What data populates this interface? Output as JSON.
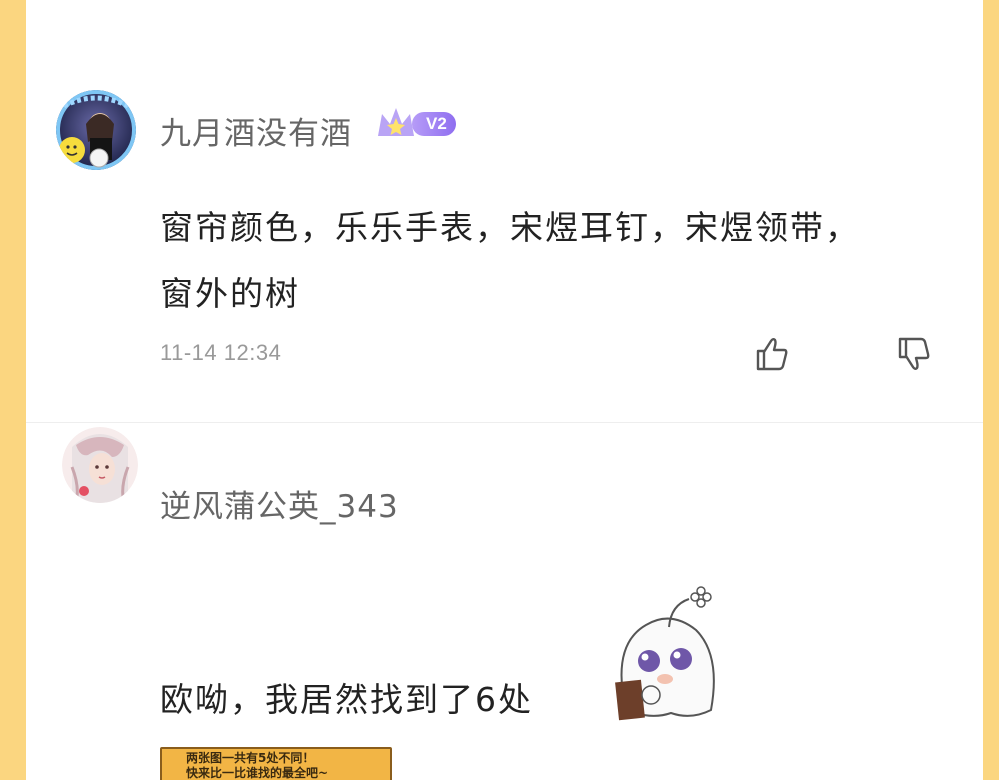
{
  "comments": [
    {
      "username": "九月酒没有酒",
      "level_badge": "V2",
      "text_line1": "窗帘颜色，乐乐手表，宋煜耳钉，宋煜领带，",
      "text_line2": "窗外的树",
      "timestamp": "11-14 12:34"
    },
    {
      "username": "逆风蒲公英_343",
      "text": "欧呦，我居然找到了6处",
      "attached_image": {
        "line1": "两张图一共有5处不同！",
        "line2": "快来比一比谁找的最全吧~"
      }
    }
  ],
  "colors": {
    "page_background": "#fbd680",
    "panel": "#ffffff",
    "badge": "#9b7cf2"
  },
  "icons": {
    "like": "thumbs-up-icon",
    "dislike": "thumbs-down-icon",
    "crown": "crown-icon"
  }
}
